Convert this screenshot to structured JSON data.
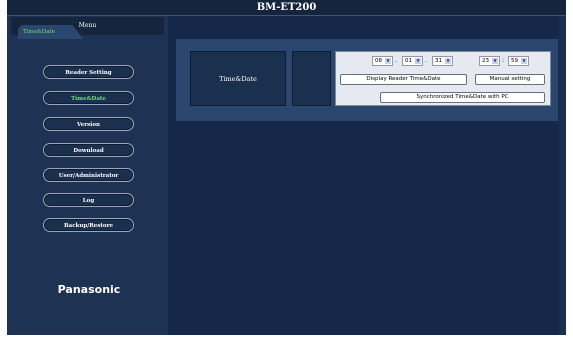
{
  "window": {
    "title": "BM-ET200"
  },
  "sidebar": {
    "menu_title": "Menu",
    "items": [
      {
        "label": "Reader Setting",
        "active": false
      },
      {
        "label": "Time&Date",
        "active": true
      },
      {
        "label": "Version",
        "active": false
      },
      {
        "label": "Download",
        "active": false
      },
      {
        "label": "User/Administrator",
        "active": false
      },
      {
        "label": "Log",
        "active": false
      },
      {
        "label": "Backup/Restore",
        "active": false
      }
    ],
    "brand": "Panasonic"
  },
  "main": {
    "tab_label": "Time&Date",
    "row_label": "Time&Date",
    "fields": {
      "year": "08",
      "month": "01",
      "day": "31",
      "hour": "23",
      "minute": "59",
      "date_separator": ".",
      "time_separator": ":"
    },
    "buttons": {
      "display_reader": "Display Reader Time&Date",
      "manual_setting": "Manual setting",
      "sync_pc": "Synchronized Time&Date with PC"
    }
  },
  "colors": {
    "background": "#1b2f4e",
    "title_bar": "#15253e",
    "tab": "#2c476f",
    "active_text": "#6fe06f"
  }
}
